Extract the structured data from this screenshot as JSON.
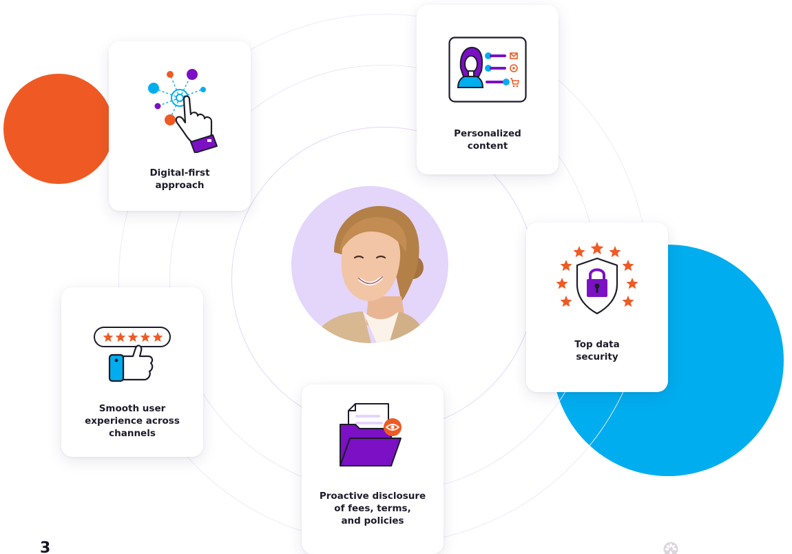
{
  "colors": {
    "orange": "#ef5a24",
    "blue": "#00adef",
    "purple": "#7b10c4",
    "light_purple": "#e4d5fb",
    "ring": "#ece7f8",
    "text": "#1c1b29"
  },
  "cards": {
    "digital_first": {
      "icon": "hand-pointer-network-icon",
      "label_lines": [
        "Digital-first",
        "approach"
      ]
    },
    "personalized": {
      "icon": "profile-card-icon",
      "label_lines": [
        "Personalized",
        "content"
      ]
    },
    "security": {
      "icon": "shield-lock-icon",
      "label_lines": [
        "Top data",
        "security"
      ]
    },
    "smooth": {
      "icon": "thumbs-up-rating-icon",
      "label_lines": [
        "Smooth user",
        "experience across",
        "channels"
      ]
    },
    "disclosure": {
      "icon": "folder-eye-icon",
      "label_lines": [
        "Proactive disclosure",
        "of fees, terms,",
        "and policies"
      ]
    }
  },
  "page_number": "3",
  "central_image": "smiling-woman-portrait",
  "corner_logo": "flower-logo-icon"
}
